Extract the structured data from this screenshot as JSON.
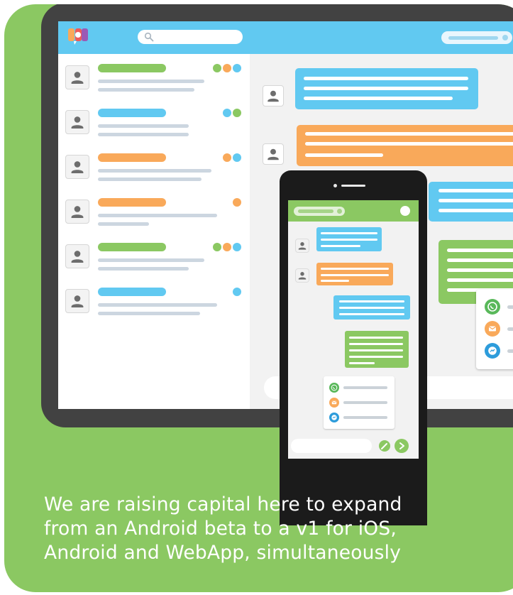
{
  "caption": {
    "line1": "We are raising capital here to expand",
    "line2": "from an Android beta to a v1 for iOS,",
    "line3": "Android and WebApp, simultaneously"
  },
  "colors": {
    "background": "#8bc862",
    "device_frame": "#424242",
    "blue": "#61c9f1",
    "orange": "#f9a95a",
    "green": "#8bc862",
    "placeholder_line": "#ccd6e0"
  },
  "desktop": {
    "icons": [
      "app-logo-icon",
      "search-icon",
      "person-icon"
    ],
    "contacts": [
      {
        "name_color": "green",
        "status_dots": [
          "green",
          "orange",
          "blue"
        ]
      },
      {
        "name_color": "blue",
        "status_dots": [
          "blue",
          "green"
        ]
      },
      {
        "name_color": "orange",
        "status_dots": [
          "orange",
          "blue"
        ]
      },
      {
        "name_color": "orange",
        "status_dots": [
          "orange"
        ]
      },
      {
        "name_color": "green",
        "status_dots": [
          "green",
          "orange",
          "blue"
        ]
      },
      {
        "name_color": "blue",
        "status_dots": [
          "blue"
        ]
      }
    ],
    "messages": [
      {
        "color": "blue",
        "side": "left"
      },
      {
        "color": "orange",
        "side": "left"
      },
      {
        "color": "blue",
        "side": "right"
      },
      {
        "color": "green",
        "side": "right"
      }
    ],
    "app_options": [
      "whatsapp-icon",
      "email-icon",
      "messenger-icon"
    ]
  },
  "phone": {
    "messages": [
      {
        "color": "blue",
        "side": "left"
      },
      {
        "color": "orange",
        "side": "left"
      },
      {
        "color": "blue",
        "side": "right"
      },
      {
        "color": "green",
        "side": "right"
      }
    ],
    "app_options": [
      "whatsapp-icon",
      "email-icon",
      "messenger-icon"
    ],
    "icons": [
      "person-icon",
      "attach-icon",
      "send-icon"
    ]
  }
}
